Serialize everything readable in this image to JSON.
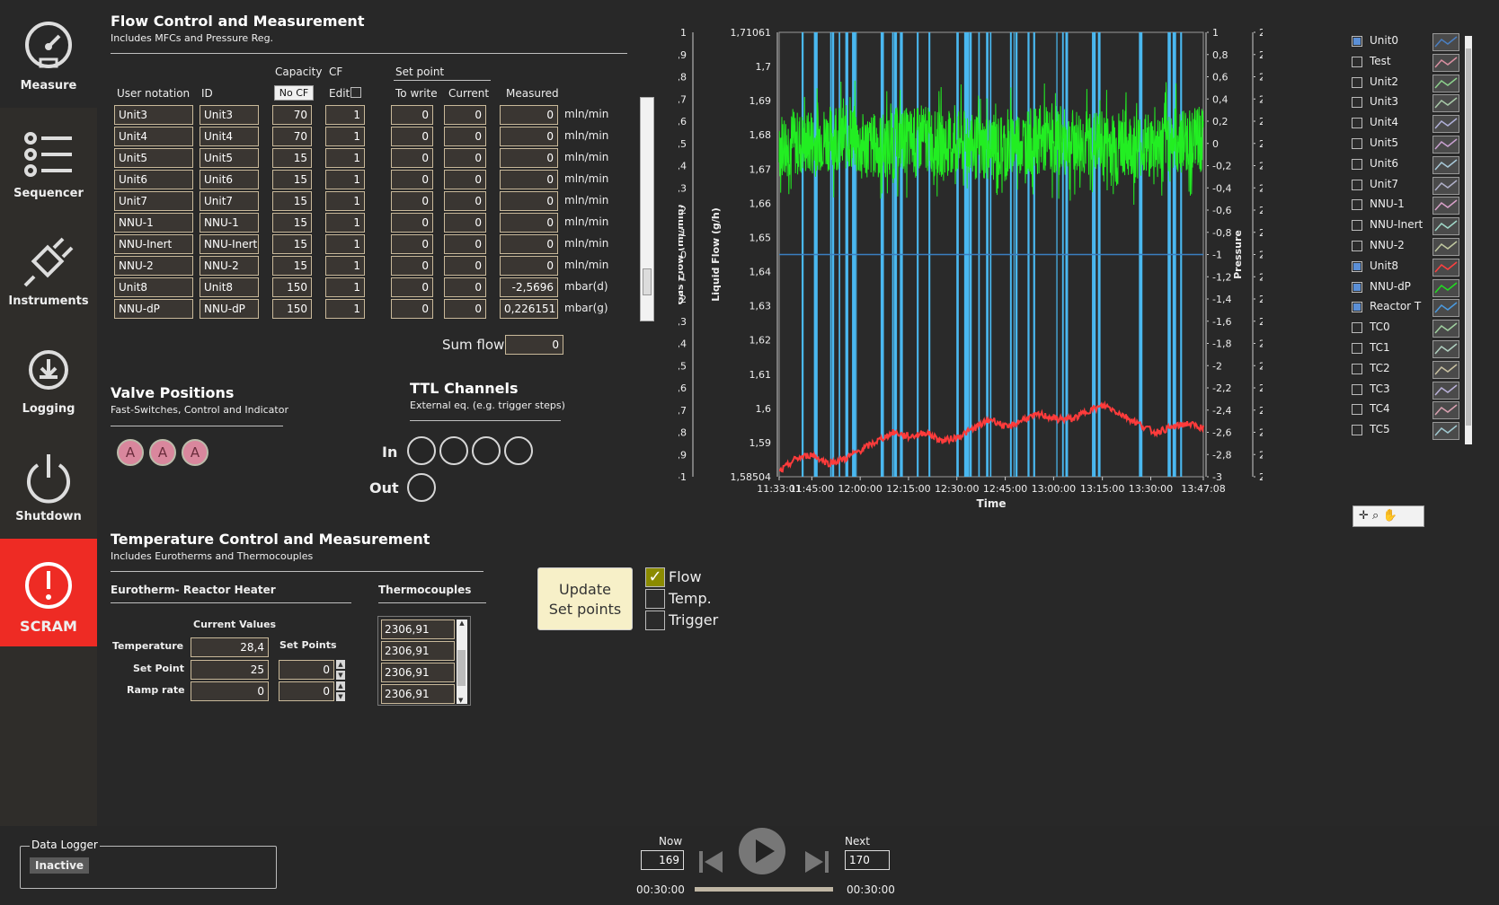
{
  "nav": {
    "items": [
      {
        "label": "Measure",
        "icon": "gauge-icon"
      },
      {
        "label": "Sequencer",
        "icon": "list-icon"
      },
      {
        "label": "Instruments",
        "icon": "plug-icon"
      },
      {
        "label": "Logging",
        "icon": "gear-download-icon"
      },
      {
        "label": "Shutdown",
        "icon": "power-icon"
      },
      {
        "label": "SCRAM",
        "icon": "alert-icon"
      }
    ]
  },
  "flow": {
    "title": "Flow Control and Measurement",
    "subtitle": "Includes MFCs and Pressure Reg.",
    "headers": {
      "user_notation": "User notation",
      "id": "ID",
      "capacity": "Capacity",
      "cf": "CF",
      "no_cf": "No CF",
      "edit": "Edit",
      "set_point": "Set point",
      "to_write": "To write",
      "current": "Current",
      "measured": "Measured"
    },
    "rows": [
      {
        "name": "Unit3",
        "id": "Unit3",
        "capacity": "70",
        "cf": "1",
        "to_write": "0",
        "current": "0",
        "measured": "0",
        "unit": "mln/min"
      },
      {
        "name": "Unit4",
        "id": "Unit4",
        "capacity": "70",
        "cf": "1",
        "to_write": "0",
        "current": "0",
        "measured": "0",
        "unit": "mln/min"
      },
      {
        "name": "Unit5",
        "id": "Unit5",
        "capacity": "15",
        "cf": "1",
        "to_write": "0",
        "current": "0",
        "measured": "0",
        "unit": "mln/min"
      },
      {
        "name": "Unit6",
        "id": "Unit6",
        "capacity": "15",
        "cf": "1",
        "to_write": "0",
        "current": "0",
        "measured": "0",
        "unit": "mln/min"
      },
      {
        "name": "Unit7",
        "id": "Unit7",
        "capacity": "15",
        "cf": "1",
        "to_write": "0",
        "current": "0",
        "measured": "0",
        "unit": "mln/min"
      },
      {
        "name": "NNU-1",
        "id": "NNU-1",
        "capacity": "15",
        "cf": "1",
        "to_write": "0",
        "current": "0",
        "measured": "0",
        "unit": "mln/min"
      },
      {
        "name": "NNU-Inert",
        "id": "NNU-Inert",
        "capacity": "15",
        "cf": "1",
        "to_write": "0",
        "current": "0",
        "measured": "0",
        "unit": "mln/min"
      },
      {
        "name": "NNU-2",
        "id": "NNU-2",
        "capacity": "15",
        "cf": "1",
        "to_write": "0",
        "current": "0",
        "measured": "0",
        "unit": "mln/min"
      },
      {
        "name": "Unit8",
        "id": "Unit8",
        "capacity": "150",
        "cf": "1",
        "to_write": "0",
        "current": "0",
        "measured": "-2,5696",
        "unit": "mbar(d)"
      },
      {
        "name": "NNU-dP",
        "id": "NNU-dP",
        "capacity": "150",
        "cf": "1",
        "to_write": "0",
        "current": "0",
        "measured": "0,226151",
        "unit": "mbar(g)"
      }
    ],
    "sum_flow_label": "Sum flow",
    "sum_flow_value": "0"
  },
  "valves": {
    "title": "Valve Positions",
    "subtitle": "Fast-Switches, Control and Indicator",
    "items": [
      "A",
      "A",
      "A"
    ]
  },
  "ttl": {
    "title": "TTL Channels",
    "subtitle": "External eq. (e.g. trigger steps)",
    "in_label": "In",
    "out_label": "Out"
  },
  "temperature": {
    "title": "Temperature Control and Measurement",
    "subtitle": "Includes Eurotherms and Thermocouples",
    "eurotherm_title": "Eurotherm- Reactor Heater",
    "thermocouples_title": "Thermocouples",
    "current_values_label": "Current Values",
    "set_points_label": "Set Points",
    "rows": [
      {
        "label": "Temperature",
        "current": "28,4",
        "set": null
      },
      {
        "label": "Set Point",
        "current": "25",
        "set": "0"
      },
      {
        "label": "Ramp rate",
        "current": "0",
        "set": "0"
      }
    ],
    "thermocouples": [
      "2306,91",
      "2306,91",
      "2306,91",
      "2306,91"
    ]
  },
  "update": {
    "button_label_1": "Update",
    "button_label_2": "Set points",
    "checks": [
      {
        "label": "Flow",
        "checked": true
      },
      {
        "label": "Temp.",
        "checked": false
      },
      {
        "label": "Trigger",
        "checked": false
      }
    ]
  },
  "chart_data": {
    "type": "line",
    "xlabel": "Time",
    "ylabels": [
      "Gas Flow (ml/min)",
      "Liquid Flow (g/h)",
      "Pressure",
      "Temperature (°C)"
    ],
    "x_ticks": [
      "11:33:01",
      "11:45:00",
      "12:00:00",
      "12:15:00",
      "12:30:00",
      "12:45:00",
      "13:00:00",
      "13:15:00",
      "13:30:00",
      "13:47:08"
    ],
    "axis1_ticks": [
      "1",
      "0,9",
      "0,8",
      "0,7",
      "0,6",
      "0,5",
      "0,4",
      "0,3",
      "0,2",
      "0,1",
      "0",
      "-0,1",
      "-0,2",
      "-0,3",
      "-0,4",
      "-0,5",
      "-0,6",
      "-0,7",
      "-0,8",
      "-0,9",
      "-1"
    ],
    "axis2_ticks": [
      "1,71061",
      "1,7",
      "1,69",
      "1,68",
      "1,67",
      "1,66",
      "1,65",
      "1,64",
      "1,63",
      "1,62",
      "1,61",
      "1,6",
      "1,59",
      "1,58504"
    ],
    "axis3_ticks": [
      "1",
      "0,8",
      "0,6",
      "0,4",
      "0,2",
      "0",
      "-0,2",
      "-0,4",
      "-0,6",
      "-0,8",
      "-1",
      "-1,2",
      "-1,4",
      "-1,6",
      "-1,8",
      "-2",
      "-2,2",
      "-2,4",
      "-2,6",
      "-2,8",
      "-3"
    ],
    "axis4_ticks": [
      "28,5",
      "28,495",
      "28,49",
      "28,485",
      "28,48",
      "28,475",
      "28,47",
      "28,465",
      "28,46",
      "28,455",
      "28,45",
      "28,445",
      "28,44",
      "28,435",
      "28,43",
      "28,425",
      "28,42",
      "28,415",
      "28,41",
      "28,405",
      "28,4"
    ],
    "series": [
      {
        "name": "Unit8",
        "color": "#ff3b3b",
        "values": [
          28.401,
          28.404,
          28.405,
          28.403,
          28.404,
          28.406,
          28.408,
          28.41,
          28.409,
          28.41,
          28.408,
          28.409,
          28.411,
          28.413,
          28.411,
          28.413,
          28.414,
          28.413,
          28.413,
          28.415,
          28.416,
          28.414,
          28.412,
          28.41,
          28.411,
          28.412,
          28.411
        ]
      },
      {
        "name": "NNU-dP",
        "color": "#22ee22",
        "values": [
          0.0,
          0.05,
          -0.02,
          0.03,
          0.0,
          -0.04,
          0.02,
          0.01,
          0.0,
          -0.02,
          0.03,
          0.0
        ]
      },
      {
        "name": "Reactor T",
        "color": "#4ab8f0",
        "values": [
          0,
          0
        ]
      }
    ]
  },
  "legend": {
    "items": [
      {
        "name": "Unit0",
        "checked": true
      },
      {
        "name": "Test",
        "checked": false
      },
      {
        "name": "Unit2",
        "checked": false
      },
      {
        "name": "Unit3",
        "checked": false
      },
      {
        "name": "Unit4",
        "checked": false
      },
      {
        "name": "Unit5",
        "checked": false
      },
      {
        "name": "Unit6",
        "checked": false
      },
      {
        "name": "Unit7",
        "checked": false
      },
      {
        "name": "NNU-1",
        "checked": false
      },
      {
        "name": "NNU-Inert",
        "checked": false
      },
      {
        "name": "NNU-2",
        "checked": false
      },
      {
        "name": "Unit8",
        "checked": true
      },
      {
        "name": "NNU-dP",
        "checked": true
      },
      {
        "name": "Reactor T",
        "checked": true
      },
      {
        "name": "TC0",
        "checked": false
      },
      {
        "name": "TC1",
        "checked": false
      },
      {
        "name": "TC2",
        "checked": false
      },
      {
        "name": "TC3",
        "checked": false
      },
      {
        "name": "TC4",
        "checked": false
      },
      {
        "name": "TC5",
        "checked": false
      }
    ],
    "colors": [
      "#4a7fc1",
      "#d88fa0",
      "#8ccf8c",
      "#a8c8a8",
      "#b0b0d8",
      "#c8a0d0",
      "#a8c8d8",
      "#b0b0c8",
      "#d8a0c8",
      "#a0d8c8",
      "#c0c8a0",
      "#ff4040",
      "#22dd22",
      "#4a9ae0",
      "#a0d0a0",
      "#b0d0c0",
      "#c8c0a0",
      "#b8b0d8",
      "#d8a0b0",
      "#a0c8d0"
    ]
  },
  "datalogger": {
    "title": "Data Logger",
    "status": "Inactive"
  },
  "player": {
    "now_label": "Now",
    "now_value": "169",
    "next_label": "Next",
    "next_value": "170",
    "time_left": "00:30:00",
    "time_right": "00:30:00"
  }
}
